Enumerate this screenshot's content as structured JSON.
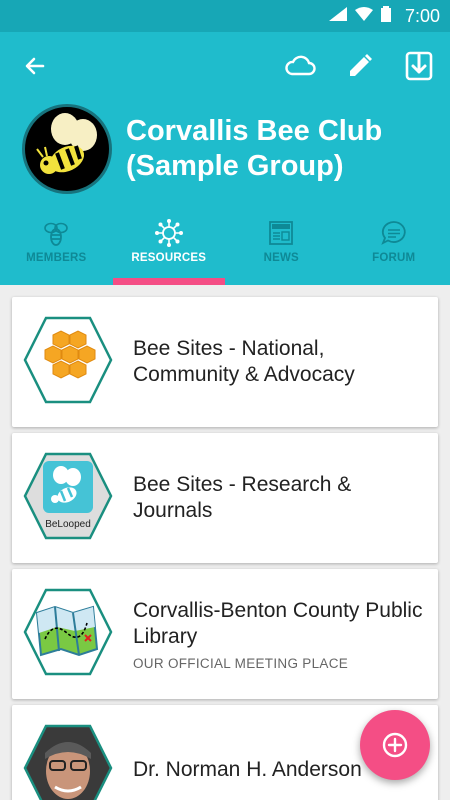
{
  "status_bar": {
    "time": "7:00"
  },
  "group": {
    "name": "Corvallis Bee Club (Sample Group)"
  },
  "tabs": [
    {
      "label": "MEMBERS",
      "icon": "bee-icon",
      "active": false
    },
    {
      "label": "RESOURCES",
      "icon": "network-icon",
      "active": true
    },
    {
      "label": "NEWS",
      "icon": "newspaper-icon",
      "active": false
    },
    {
      "label": "FORUM",
      "icon": "chat-bubble-icon",
      "active": false
    }
  ],
  "resources": [
    {
      "title": "Bee Sites - National, Community & Advocacy",
      "subtitle": "",
      "icon": "honeycomb-icon"
    },
    {
      "title": "Bee Sites - Research & Journals",
      "subtitle": "",
      "icon": "belooped-bee-icon",
      "icon_caption": "BeLooped"
    },
    {
      "title": "Corvallis-Benton County Public Library",
      "subtitle": "OUR OFFICIAL MEETING PLACE",
      "icon": "map-icon"
    },
    {
      "title": "Dr. Norman H. Anderson",
      "subtitle": "",
      "icon": "person-photo"
    }
  ],
  "colors": {
    "primary": "#1fbccc",
    "status_bar": "#17a7b6",
    "accent": "#f44e85",
    "hex_border": "#1a8f80"
  }
}
